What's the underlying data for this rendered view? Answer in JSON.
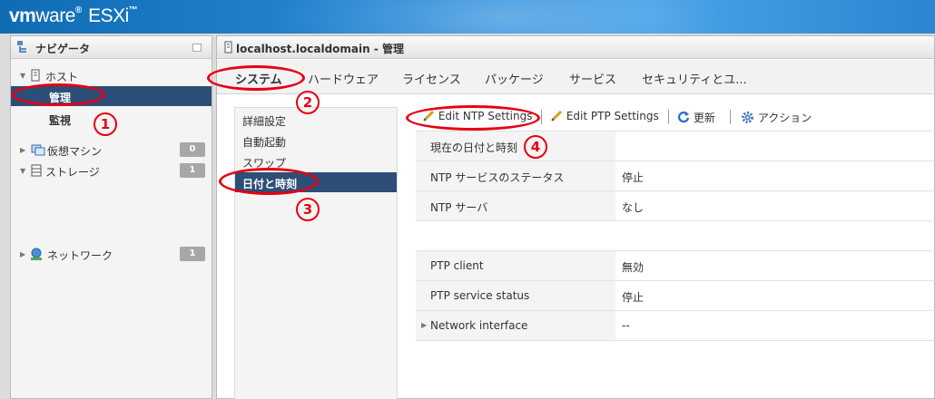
{
  "header": {
    "brand_vm": "vm",
    "brand_ware": "ware",
    "brand_esxi": "ESXi"
  },
  "navigator": {
    "title": "ナビゲータ",
    "host_label": "ホスト",
    "manage_label": "管理",
    "monitor_label": "監視",
    "vms_label": "仮想マシン",
    "vms_count": "0",
    "storage_label": "ストレージ",
    "storage_count": "1",
    "network_label": "ネットワーク",
    "network_count": "1"
  },
  "main": {
    "title": "localhost.localdomain - 管理",
    "tabs": [
      "システム",
      "ハードウェア",
      "ライセンス",
      "パッケージ",
      "サービス",
      "セキュリティとユ..."
    ],
    "sub_nav": [
      "詳細設定",
      "自動起動",
      "スワップ",
      "日付と時刻"
    ],
    "toolbar": {
      "edit_ntp": "Edit NTP Settings",
      "edit_ptp": "Edit PTP Settings",
      "refresh": "更新",
      "actions": "アクション"
    },
    "ntp_table": [
      {
        "key": "現在の日付と時刻",
        "value": ""
      },
      {
        "key": "NTP サービスのステータス",
        "value": "停止"
      },
      {
        "key": "NTP サーバ",
        "value": "なし"
      }
    ],
    "ptp_table": [
      {
        "key": "PTP client",
        "value": "無効"
      },
      {
        "key": "PTP service status",
        "value": "停止"
      },
      {
        "key": "Network interface",
        "value": "--"
      }
    ]
  },
  "annotations": {
    "n1": "1",
    "n2": "2",
    "n3": "3",
    "n4": "4"
  },
  "colors": {
    "accent": "#2d4e76",
    "annotation": "#e60012",
    "header_blue": "#1a7ac6"
  }
}
